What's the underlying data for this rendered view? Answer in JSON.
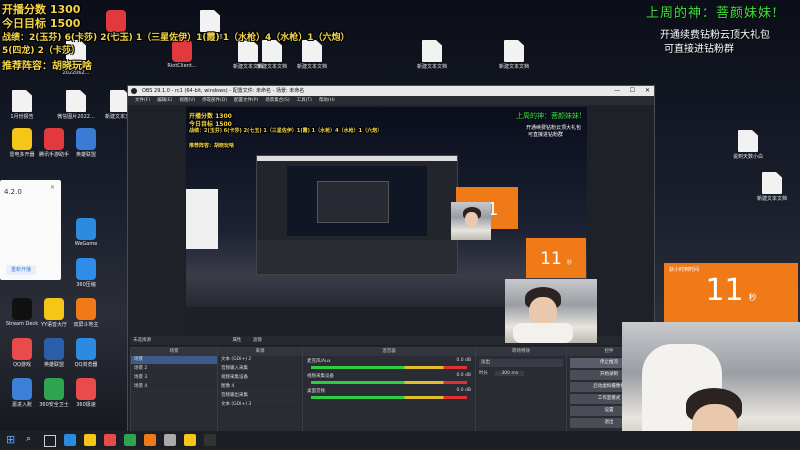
{
  "overlay": {
    "line1": "开播分数 1300",
    "line2": "今日目标 1500",
    "line3": "战绩：2(玉芬) 6(卡莎) 2(七玉) 1（三星佐伊）1(霞) 1（水枪）4（水枪）1（六炮）",
    "line4": "5(四龙) 2（卡莎）",
    "line5": "推荐阵容：胡晓玩啥",
    "god_title": "上周的神：菩颜妹妹!",
    "promo1": "开通续费钻粉云顶大礼包",
    "promo2": "可直接进钻粉群"
  },
  "timer": {
    "big_value": "11",
    "big_unit": "秒",
    "big_label": "获小时到时间",
    "small_value": "11",
    "small_unit": "秒"
  },
  "desktop_icons": [
    {
      "label": "Riot Client",
      "kind": "app",
      "color": "#e0393e"
    },
    {
      "label": "RiotClient...",
      "kind": "app",
      "color": "#e0393e"
    },
    {
      "label": "新建文本文档",
      "kind": "file"
    },
    {
      "label": "新建文本文档",
      "kind": "file"
    },
    {
      "label": "新建文本文档",
      "kind": "file"
    },
    {
      "label": "新建文本文档",
      "kind": "file"
    },
    {
      "label": "1月份报告",
      "kind": "file"
    },
    {
      "label": "雷电多开器",
      "kind": "app",
      "color": "#f5c518"
    },
    {
      "label": "腾讯手游助手",
      "kind": "app",
      "color": "#e0393e"
    },
    {
      "label": "英雄联盟",
      "kind": "app",
      "color": "#3a7bd5"
    },
    {
      "label": "WeGame",
      "kind": "app",
      "color": "#2b8be0"
    },
    {
      "label": "360压缩",
      "kind": "app",
      "color": "#2e8be6"
    },
    {
      "label": "Stream Deck",
      "kind": "app",
      "color": "#111"
    },
    {
      "label": "YY语音大厅",
      "kind": "app",
      "color": "#f5c518"
    },
    {
      "label": "双屏斗地主",
      "kind": "app",
      "color": "#f07a18"
    },
    {
      "label": "QQ游戏",
      "kind": "app",
      "color": "#e94b4b"
    },
    {
      "label": "英雄联盟",
      "kind": "app",
      "color": "#2a5ea8"
    },
    {
      "label": "QQ浏览器",
      "kind": "app",
      "color": "#2b8be0"
    },
    {
      "label": "嘉进入账",
      "kind": "app",
      "color": "#3b7fd9"
    },
    {
      "label": "360安全卫士",
      "kind": "app",
      "color": "#2ea44f"
    },
    {
      "label": "360极速",
      "kind": "app",
      "color": "#e94b4b"
    },
    {
      "label": "云顶大礼包",
      "kind": "file"
    },
    {
      "label": "新建文本文档",
      "kind": "file"
    },
    {
      "label": "说到天数小白",
      "kind": "file"
    },
    {
      "label": "新建文本文档",
      "kind": "file"
    },
    {
      "label": "微信图片2022062...",
      "kind": "file"
    },
    {
      "label": "微信图片2022...",
      "kind": "file"
    },
    {
      "label": "新建文本文档",
      "kind": "file"
    }
  ],
  "popup": {
    "version": "4.2.0",
    "button": "重新开播"
  },
  "obs": {
    "title": "OBS 29.1.0 - rc1 (64-bit, windows) - 配置文件: 未命名 - 场景: 未命名",
    "menu": [
      "文件(F)",
      "编辑(E)",
      "视图(V)",
      "停靠部件(D)",
      "配置文件(P)",
      "场景集合(S)",
      "工具(T)",
      "帮助(H)"
    ],
    "no_source": "未选择源",
    "properties": "属性",
    "filters": "滤镜",
    "scenes_header": "场景",
    "scenes": [
      "场景",
      "场景 2",
      "场景 3",
      "场景 4"
    ],
    "sources_header": "来源",
    "sources": [
      "文本 (GDI+) 2",
      "音频输入采集",
      "视频采集设备",
      "图像 4",
      "音频输出采集",
      "文本 (GDI+) 3"
    ],
    "mixer_header": "混音器",
    "mixer": [
      {
        "name": "麦克风/Aux",
        "db": "0.0 dB"
      },
      {
        "name": "视频采集设备",
        "db": "0.0 dB"
      },
      {
        "name": "桌面音频",
        "db": "0.0 dB"
      }
    ],
    "transitions_header": "转场特效",
    "transition": "淡出",
    "duration_label": "时长",
    "duration": "300 ms",
    "controls_header": "控件",
    "controls": [
      "停止推流",
      "开始录制",
      "启动虚拟摄像机",
      "工作室模式",
      "设置",
      "退出"
    ]
  },
  "taskbar": {
    "colors": [
      "#2b8be0",
      "#f5c518",
      "#e94b4b",
      "#2ea44f",
      "#f07a18",
      "#aaaaaa",
      "#f5c518",
      "#333"
    ]
  }
}
